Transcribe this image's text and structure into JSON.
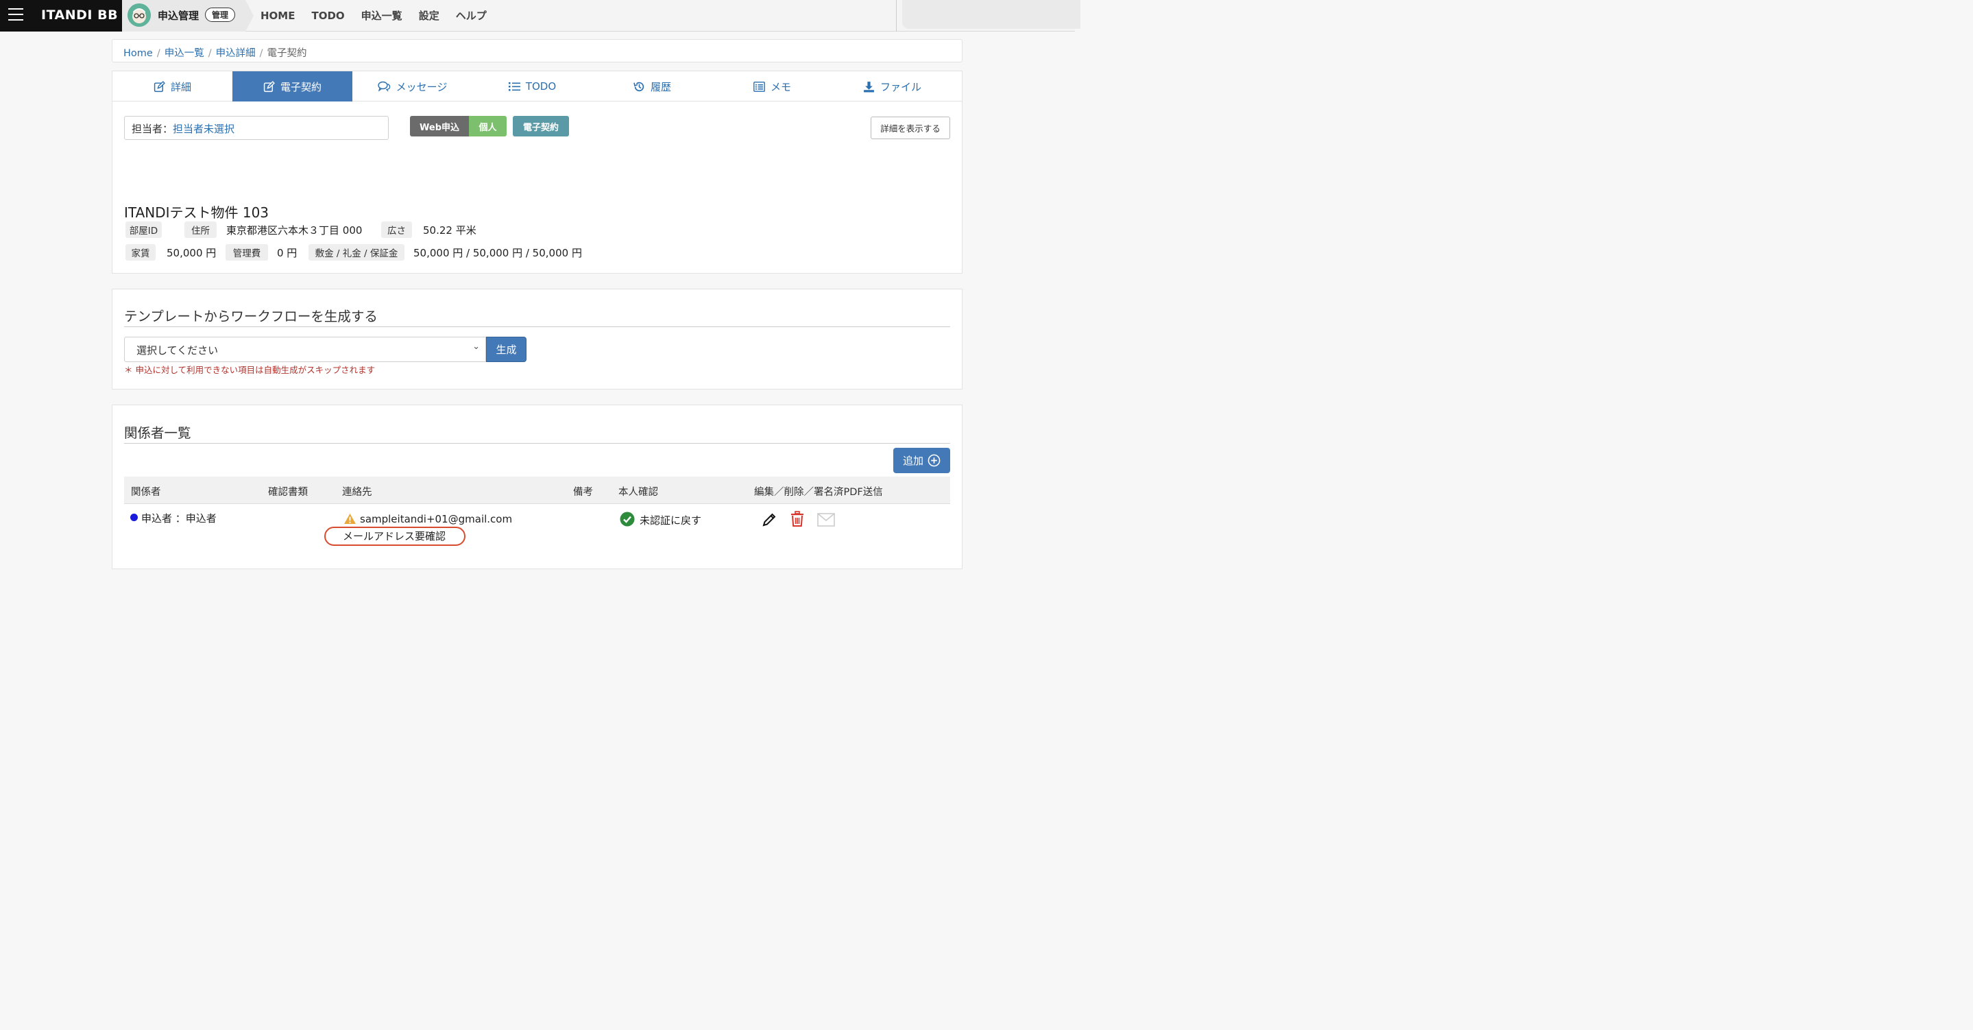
{
  "topbar": {
    "brand": "ITANDI BB",
    "app_title": "申込管理",
    "app_badge": "管理",
    "nav": [
      "HOME",
      "TODO",
      "申込一覧",
      "設定",
      "ヘルプ"
    ]
  },
  "breadcrumb": {
    "items": [
      "Home",
      "申込一覧",
      "申込詳細"
    ],
    "current": "電子契約"
  },
  "tabs": [
    {
      "label": "詳細",
      "icon": "edit-icon"
    },
    {
      "label": "電子契約",
      "icon": "edit-icon",
      "active": true
    },
    {
      "label": "メッセージ",
      "icon": "chat-icon"
    },
    {
      "label": "TODO",
      "icon": "list-icon"
    },
    {
      "label": "履歴",
      "icon": "history-icon"
    },
    {
      "label": "メモ",
      "icon": "memo-icon"
    },
    {
      "label": "ファイル",
      "icon": "download-icon"
    }
  ],
  "detail": {
    "assignee_label": "担当者：",
    "assignee_value": "担当者未選択",
    "pills": [
      {
        "label": "Web申込",
        "color": "#6b6b6b"
      },
      {
        "label": "個人",
        "color": "#7cbf6c"
      },
      {
        "label": "電子契約",
        "color": "#5a9aa6"
      }
    ],
    "show_detail_button": "詳細を表示する",
    "property_name": "ITANDIテスト物件 103",
    "room_id_label": "部屋ID",
    "room_id_value": "",
    "address_label": "住所",
    "address_value": "東京都港区六本木３丁目 000",
    "area_label": "広さ",
    "area_value": "50.22 平米",
    "rent_label": "家賃",
    "rent_value": "50,000 円",
    "mgmt_label": "管理費",
    "mgmt_value": "0 円",
    "deposit_label": "敷金 / 礼金 / 保証金",
    "deposit_value": "50,000 円 / 50,000 円 / 50,000 円"
  },
  "workflow": {
    "title": "テンプレートからワークフローを生成する",
    "select_value": "選択してください",
    "generate_button": "生成",
    "note": "＊ 申込に対して利用できない項目は自動生成がスキップされます"
  },
  "parties": {
    "title": "関係者一覧",
    "add_button": "追加",
    "columns": [
      "関係者",
      "確認書類",
      "連絡先",
      "備考",
      "本人確認",
      "編集／削除／署名済PDF送信"
    ],
    "rows": [
      {
        "party": "申込者 ：申込者",
        "email": "sampleitandi+01@gmail.com",
        "email_check": "メールアドレス要確認",
        "verify": "未認証に戻す"
      }
    ]
  },
  "colors": {
    "accent": "#4479b7",
    "link": "#2a6fb0",
    "warning": "#b3312b",
    "delete": "#d9342b",
    "verified": "#2e8b3c",
    "dot": "#1a1adb"
  }
}
